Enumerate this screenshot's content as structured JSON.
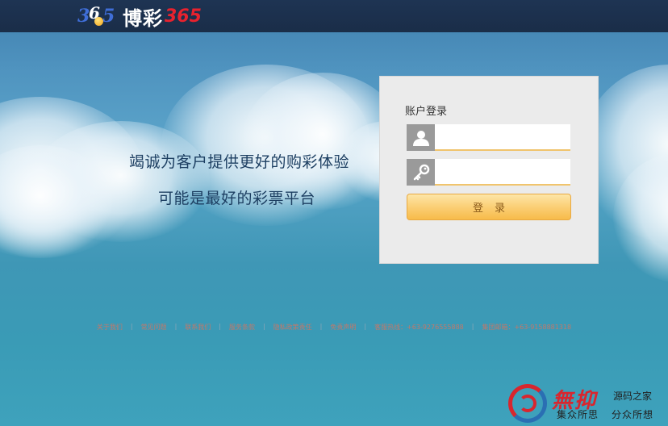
{
  "header": {
    "logo_digits": [
      "3",
      "6",
      "5"
    ],
    "logo_name": "博彩",
    "logo_number": "365"
  },
  "slogans": {
    "line1": "竭诚为客户提供更好的购彩体验",
    "line2": "可能是最好的彩票平台"
  },
  "login": {
    "title": "账户登录",
    "username_value": "",
    "password_value": "",
    "user_icon": "user-icon",
    "key_icon": "key-icon",
    "button_label": "登录"
  },
  "footer": {
    "links": [
      "关于我们",
      "常见问题",
      "联系我们",
      "服务条款",
      "隐私政策责任",
      "免责声明",
      "客服热线：+63-9276555888",
      "集团邮箱：+63-9158881318"
    ]
  },
  "watermark": {
    "mark_text": "無抑",
    "line1": "源码之家",
    "line2a": "集众所思",
    "line2b": "分众所想"
  },
  "colors": {
    "header_bg": "#1a2d48",
    "button_gradient_top": "#fde6a8",
    "button_gradient_bottom": "#f7bb4a",
    "logo_red": "#e8222e"
  }
}
